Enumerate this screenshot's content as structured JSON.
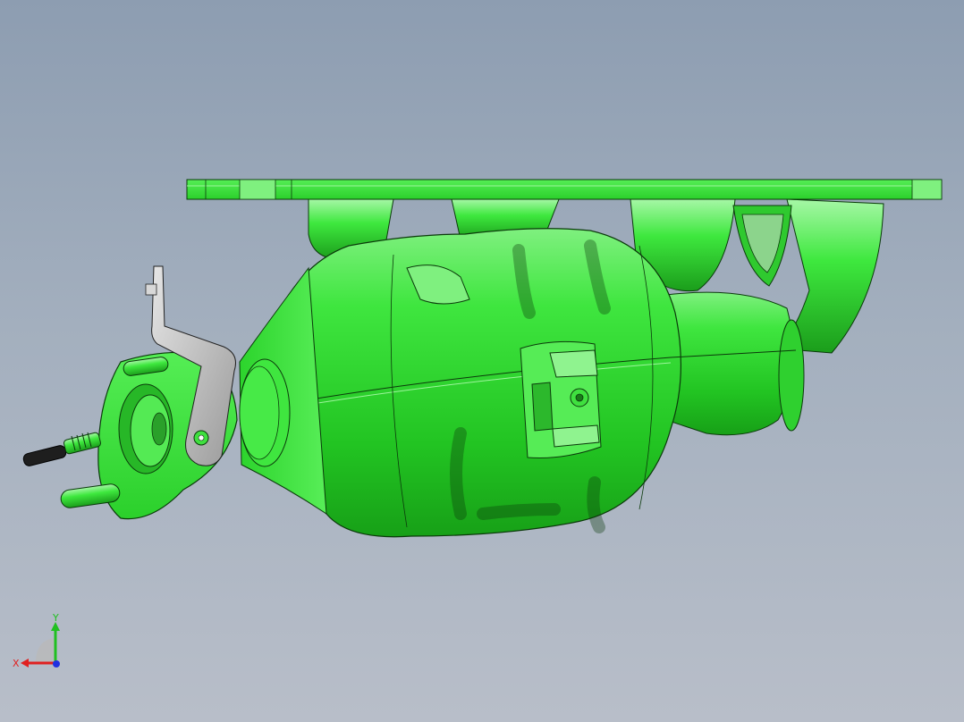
{
  "viewport": {
    "background_top": "#8d9db1",
    "background_bottom": "#b8bec9"
  },
  "model": {
    "part_color": "#39e839",
    "part_shade": "#1fa81f",
    "part_highlight": "#9df59d",
    "edge_color": "#0b3a0b",
    "bracket_color": "#c9c9c9"
  },
  "triad": {
    "x_label": "X",
    "y_label": "Y",
    "x_color": "#e02020",
    "y_color": "#20c020",
    "z_color": "#2030e0"
  }
}
